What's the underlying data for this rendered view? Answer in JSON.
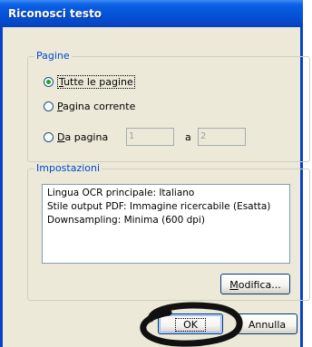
{
  "window": {
    "title": "Riconosci testo"
  },
  "pages_group": {
    "legend": "Pagine",
    "options": {
      "all": {
        "label_ul": "T",
        "label_rest": "utte le pagine",
        "checked": true
      },
      "current": {
        "label_ul": "P",
        "label_rest": "agina corrente",
        "checked": false
      },
      "range": {
        "label_ul": "D",
        "label_rest": "a pagina",
        "checked": false
      }
    },
    "from_value": "1",
    "to_label": "a",
    "to_value": "2"
  },
  "settings_group": {
    "legend": "Impostazioni",
    "lines": [
      "Lingua OCR principale: Italiano",
      "Stile output PDF: Immagine ricercabile (Esatta)",
      "Downsampling: Minima (600 dpi)"
    ],
    "modify_ul": "M",
    "modify_rest": "odifica..."
  },
  "buttons": {
    "ok": "OK",
    "cancel": "Annulla"
  },
  "colors": {
    "titlebar": "#0552d8",
    "legend": "#0046d5",
    "radio_dot": "#21a121",
    "dialog_bg": "#ece9d8"
  }
}
